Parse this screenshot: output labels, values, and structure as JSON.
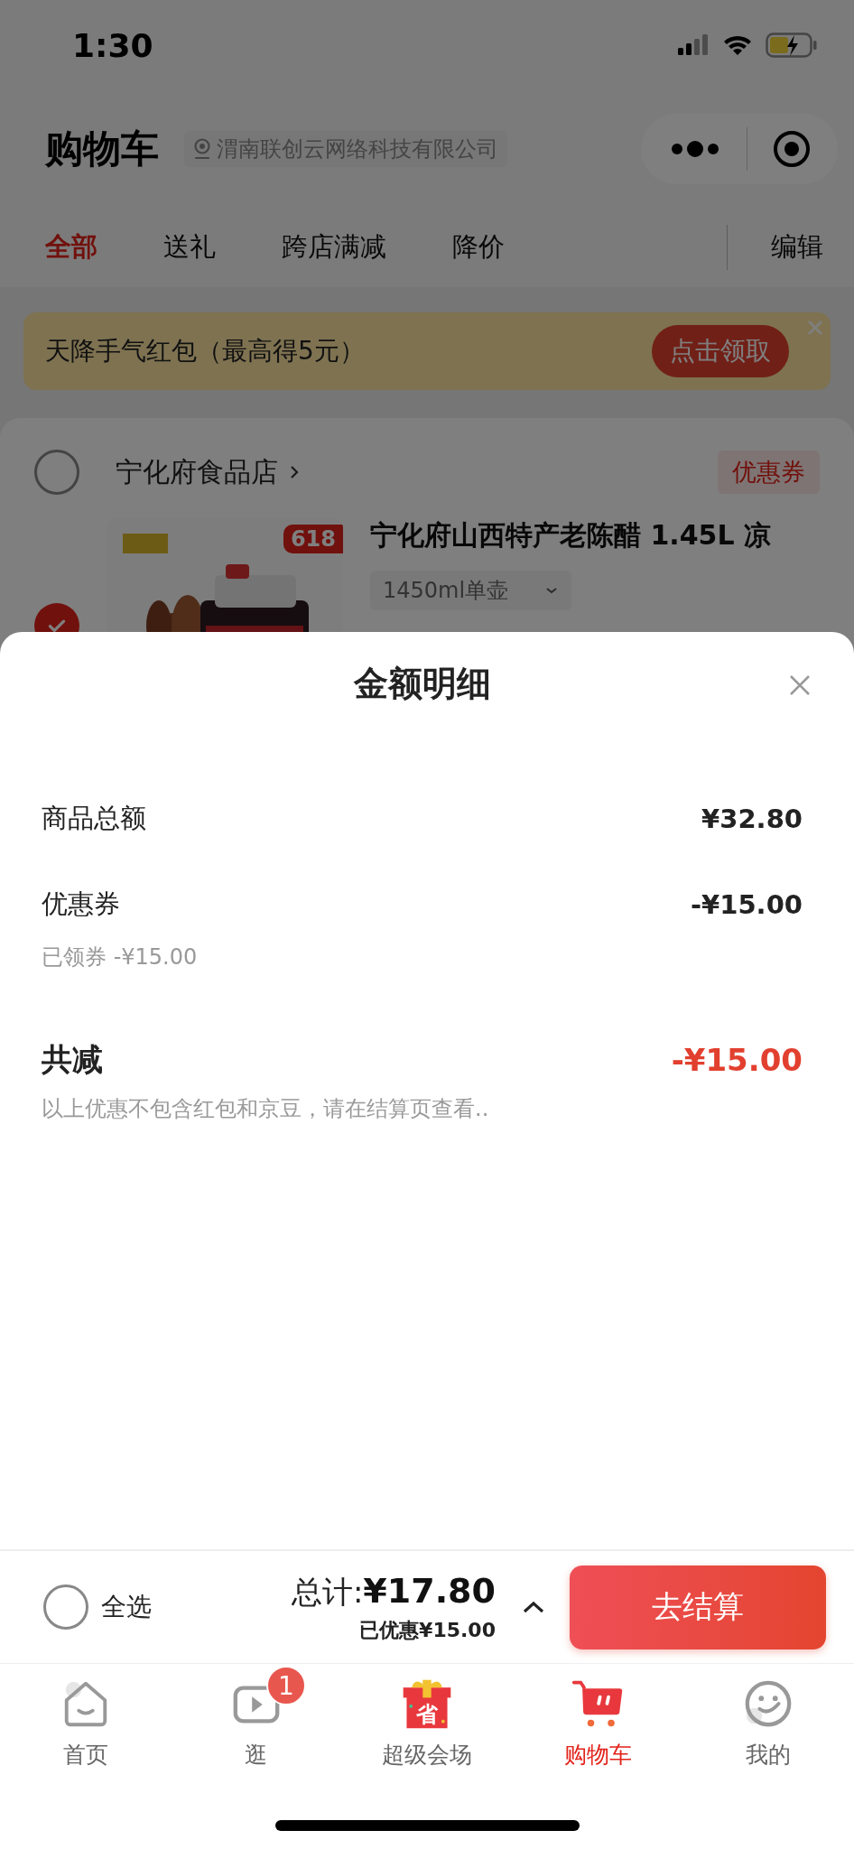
{
  "status_bar": {
    "time": "1:30"
  },
  "header": {
    "title": "购物车",
    "location": "渭南联创云网络科技有限公司"
  },
  "filter_tabs": [
    {
      "label": "全部",
      "selected": true
    },
    {
      "label": "送礼",
      "selected": false
    },
    {
      "label": "跨店满减",
      "selected": false
    },
    {
      "label": "降价",
      "selected": false
    }
  ],
  "edit_button": "编辑",
  "promo_banner": {
    "text": "天降手气红包（最高得5元）",
    "button": "点击领取"
  },
  "store": {
    "name": "宁化府食品店",
    "checked": false,
    "coupon_tag": "优惠券",
    "item": {
      "checked": true,
      "badge": "618",
      "title": "宁化府山西特产老陈醋 1.45L 凉",
      "spec": "1450ml单壶"
    }
  },
  "amount_sheet": {
    "title": "金额明细",
    "rows": [
      {
        "label": "商品总额",
        "value": "¥32.80"
      },
      {
        "label": "优惠券",
        "value": "-¥15.00",
        "note": "已领券 -¥15.00"
      }
    ],
    "total": {
      "label": "共减",
      "value": "-¥15.00"
    },
    "footnote": "以上优惠不包含红包和京豆，请在结算页查看.."
  },
  "checkout_bar": {
    "select_all": {
      "label": "全选",
      "checked": false
    },
    "total_label": "总计:",
    "total": "¥17.80",
    "discount": "已优惠¥15.00",
    "button": "去结算"
  },
  "tab_bar": [
    {
      "kind": "home",
      "label": "首页",
      "selected": false
    },
    {
      "kind": "video",
      "label": "逛",
      "badge": "1",
      "selected": false
    },
    {
      "kind": "gift",
      "label": "超级会场",
      "icon_text": "省",
      "selected": false
    },
    {
      "kind": "cart",
      "label": "购物车",
      "selected": true
    },
    {
      "kind": "face",
      "label": "我的",
      "selected": false
    }
  ]
}
